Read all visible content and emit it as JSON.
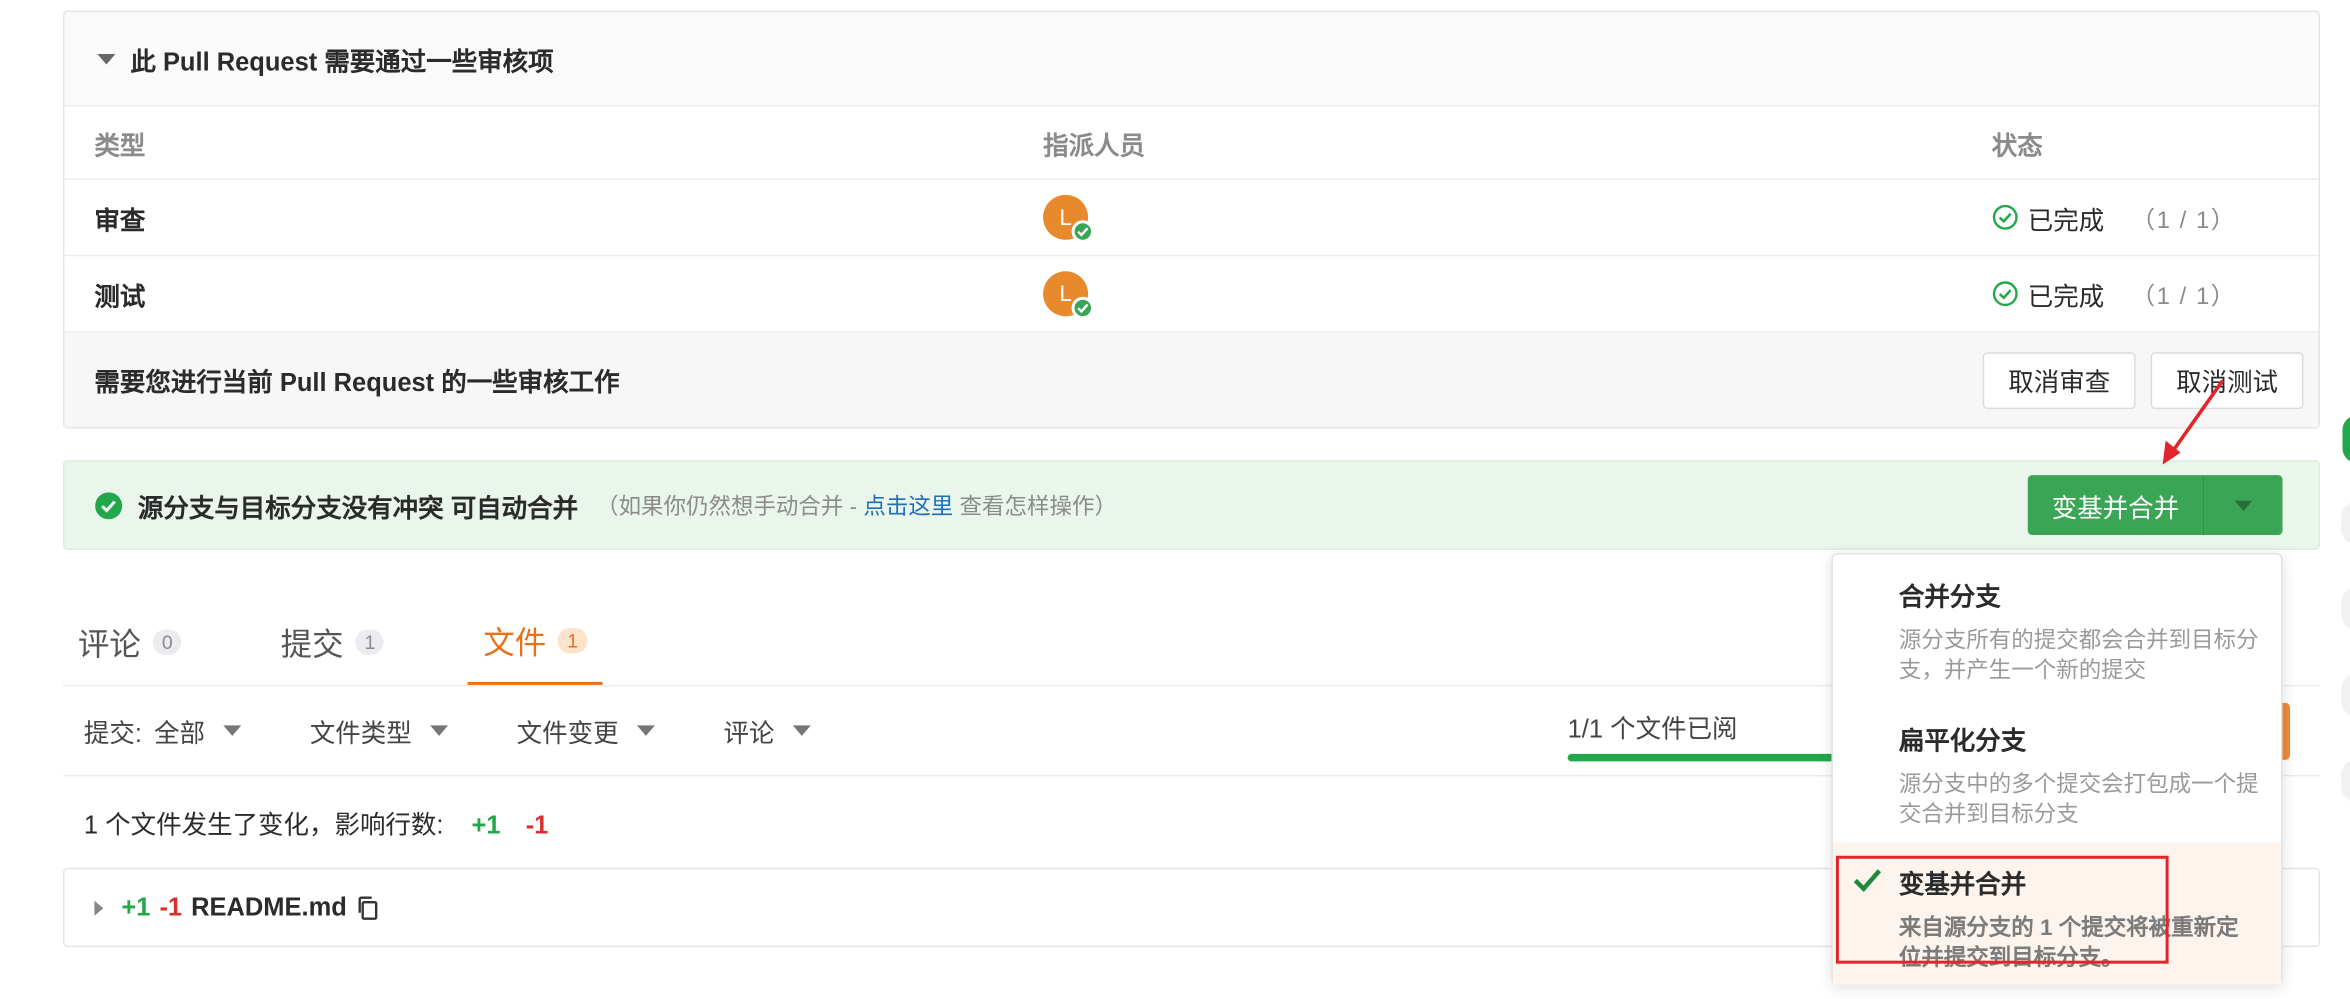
{
  "review": {
    "header": "此 Pull Request 需要通过一些审核项",
    "columns": {
      "type": "类型",
      "assignee": "指派人员",
      "status": "状态"
    },
    "rows": [
      {
        "label": "审查",
        "avatar_initial": "L",
        "status": "已完成",
        "count": "（1 / 1）"
      },
      {
        "label": "测试",
        "avatar_initial": "L",
        "status": "已完成",
        "count": "（1 / 1）"
      }
    ],
    "footer_msg": "需要您进行当前 Pull Request 的一些审核工作",
    "cancel_review": "取消审查",
    "cancel_test": "取消测试"
  },
  "merge": {
    "message": "源分支与目标分支没有冲突 可自动合并",
    "hint_prefix": "（如果你仍然想手动合并 - ",
    "hint_link": "点击这里",
    "hint_suffix": " 查看怎样操作）",
    "button_label": "变基并合并"
  },
  "tabs": [
    {
      "label": "评论",
      "count": "0"
    },
    {
      "label": "提交",
      "count": "1"
    },
    {
      "label": "文件",
      "count": "1"
    }
  ],
  "filters": {
    "commit_label": "提交:",
    "commit_value": "全部",
    "file_type": "文件类型",
    "file_change": "文件变更",
    "comment": "评论"
  },
  "progress": {
    "text": "1/1 个文件已阅",
    "fraction": 1.0
  },
  "summary": {
    "text": "1 个文件发生了变化，影响行数:",
    "plus": "+1",
    "minus": "-1"
  },
  "file": {
    "plus": "+1",
    "minus": "-1",
    "name": "README.md"
  },
  "dropdown": {
    "items": [
      {
        "title": "合并分支",
        "desc": "源分支所有的提交都会合并到目标分支，并产生一个新的提交"
      },
      {
        "title": "扁平化分支",
        "desc": "源分支中的多个提交会打包成一个提交合并到目标分支"
      },
      {
        "title": "变基并合并",
        "desc": "来自源分支的 1 个提交将被重新定位并提交到目标分支。"
      }
    ],
    "selected_index": 2
  },
  "colors": {
    "accent_green": "#3aa655",
    "accent_orange": "#e8721c",
    "highlight_red": "#e0262a"
  }
}
